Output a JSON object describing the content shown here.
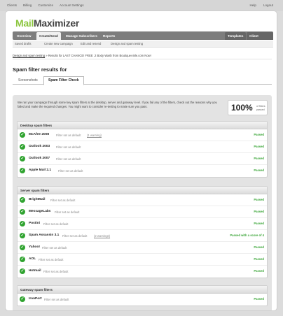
{
  "topbar": {
    "left": [
      "Clients",
      "Billing",
      "Customize",
      "Account Settings"
    ],
    "right": [
      "Help",
      "Logout"
    ]
  },
  "logo": {
    "part1": "Mail",
    "part2": "Maximizer"
  },
  "nav": {
    "overview": "Overview",
    "create_send": "Create/Send",
    "manage_subscribers": "Manage Subscribers",
    "reports": "Reports",
    "templates": "Templates",
    "client_settings": "Client Settings"
  },
  "subnav": [
    "Saved drafts",
    "Create new campaign",
    "Edit and resend",
    "Design and spam testing"
  ],
  "breadcrumb": {
    "link": "Design and spam testing",
    "text": "» Results for LAST CHANCE! FREE .2 Body Wash from BoutiqueAisle.com Now!"
  },
  "page_title": "Spam filter results for",
  "tabs": {
    "screenshots": "Screenshots",
    "spam_filter_check": "Spam Filter Check"
  },
  "intro": "We ran your campaign through some key spam filters at the desktop, server and gateway level. If you fail any of the filters, check out the reasons why you failed and make the required changes. You might want to consider re-testing to make sure you pass.",
  "score": {
    "value": "100%",
    "label": "of filters passed"
  },
  "sections": {
    "desktop": {
      "title": "Desktop spam filters",
      "rows": [
        {
          "name": "McAfee 2008",
          "note": "Filter set as default",
          "extra": "(1 warning)",
          "status": "Passed"
        },
        {
          "name": "Outlook 2003",
          "note": "Filter set as default",
          "extra": "",
          "status": "Passed"
        },
        {
          "name": "Outlook 2007",
          "note": "Filter set as default",
          "extra": "",
          "status": "Passed"
        },
        {
          "name": "Apple Mail 2.1",
          "note": "Filter set as default",
          "extra": "",
          "status": "Passed"
        }
      ]
    },
    "server": {
      "title": "Server spam filters",
      "rows": [
        {
          "name": "BrightMail",
          "note": "Filter set as default",
          "extra": "",
          "status": "Passed"
        },
        {
          "name": "MessageLabs",
          "note": "Filter set as default",
          "extra": "",
          "status": "Passed"
        },
        {
          "name": "Postini",
          "note": "Filter set as default",
          "extra": "",
          "status": "Passed"
        },
        {
          "name": "Spam Assassin 3.1",
          "note": "Filter set as default",
          "extra": "(2 warnings)",
          "status": "Passed with a score of 4"
        },
        {
          "name": "Yahoo!",
          "note": "Filter set as default",
          "extra": "",
          "status": "Passed"
        },
        {
          "name": "AOL",
          "note": "Filter set as default",
          "extra": "",
          "status": "Passed"
        },
        {
          "name": "Hotmail",
          "note": "Filter set as default",
          "extra": "",
          "status": "Passed"
        }
      ]
    },
    "gateway": {
      "title": "Gateway spam filters",
      "rows": [
        {
          "name": "IronPort",
          "note": "Filter set as default",
          "extra": "",
          "status": "Passed"
        }
      ]
    }
  }
}
